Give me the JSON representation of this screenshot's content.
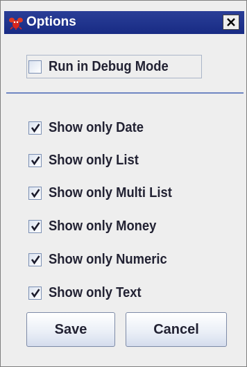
{
  "window": {
    "title": "Options",
    "icon": "lobster-app-icon",
    "close_icon": "close-x-icon"
  },
  "debug": {
    "label": "Run in Debug Mode",
    "checked": false
  },
  "options": [
    {
      "label": "Show only Date",
      "checked": true
    },
    {
      "label": "Show only List",
      "checked": true
    },
    {
      "label": "Show only Multi List",
      "checked": true
    },
    {
      "label": "Show only Money",
      "checked": true
    },
    {
      "label": "Show only Numeric",
      "checked": true
    },
    {
      "label": "Show only Text",
      "checked": true
    }
  ],
  "buttons": {
    "save": "Save",
    "cancel": "Cancel"
  },
  "colors": {
    "titlebar": "#182b84",
    "separator": "#6f86c2",
    "background": "#eeeeee"
  }
}
